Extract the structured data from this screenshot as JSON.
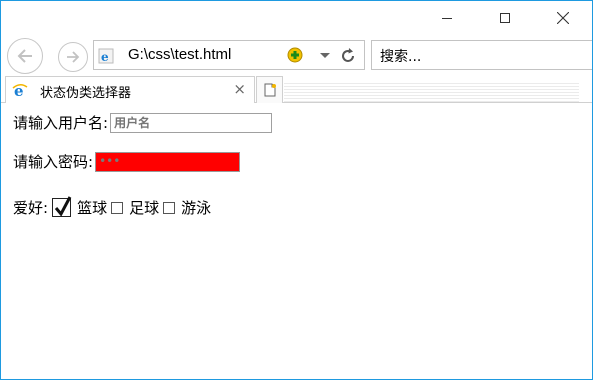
{
  "browser": {
    "address_url": "G:\\css\\test.html",
    "search_placeholder": "搜索...",
    "tab_title": "状态伪类选择器",
    "tab_close": "×"
  },
  "page": {
    "username_label": "请输入用户名:",
    "username_placeholder": "用户名",
    "password_label": "请输入密码:",
    "password_mask": "•••",
    "password_bg_color": "#ff0000",
    "hobby_label": "爱好:",
    "hobbies": [
      {
        "label": "篮球",
        "checked": true
      },
      {
        "label": "足球",
        "checked": false
      },
      {
        "label": "游泳",
        "checked": false
      }
    ]
  },
  "icons": {
    "back": "back-arrow-icon",
    "forward": "forward-arrow-icon",
    "ie": "ie-logo-icon",
    "compat": "compatibility-icon",
    "refresh": "refresh-icon",
    "new_tab": "new-tab-icon"
  },
  "colors": {
    "window_border": "#1e9ae0"
  }
}
